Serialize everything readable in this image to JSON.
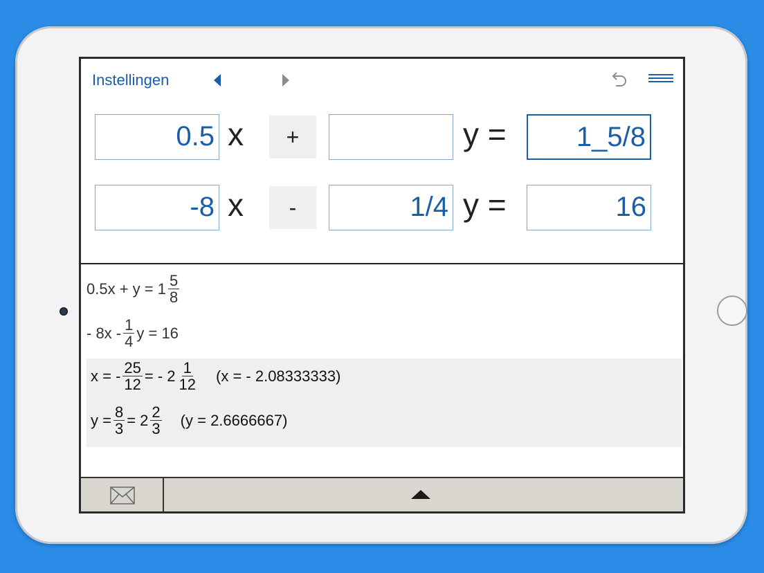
{
  "colors": {
    "background": "#2a8ce6",
    "accent": "#1a5ea8"
  },
  "nav": {
    "settings_label": "Instellingen",
    "prev_icon": "triangle-left-icon",
    "next_icon": "triangle-right-icon",
    "undo_icon": "undo-icon",
    "menu_icon": "menu-icon"
  },
  "equation1": {
    "a": "0.5",
    "x_label": "x",
    "operator": "+",
    "b": "",
    "y_label": "y =",
    "c": "1_5/8"
  },
  "equation2": {
    "a": "-8",
    "x_label": "x",
    "operator": "-",
    "b": "1/4",
    "y_label": "y =",
    "c": "16"
  },
  "results": {
    "eq1": {
      "prefix": "0.5x + y = 1",
      "frac_num": "5",
      "frac_den": "8"
    },
    "eq2": {
      "prefix": "- 8x -",
      "frac_num": "1",
      "frac_den": "4",
      "suffix": "y = 16"
    },
    "x_solution": {
      "prefix": "x = -",
      "frac1_num": "25",
      "frac1_den": "12",
      "middle": "= - 2",
      "frac2_num": "1",
      "frac2_den": "12",
      "approx": "(x = - 2.08333333)"
    },
    "y_solution": {
      "prefix": "y =",
      "frac1_num": "8",
      "frac1_den": "3",
      "middle": "= 2",
      "frac2_num": "2",
      "frac2_den": "3",
      "approx": "(y = 2.6666667)"
    }
  },
  "bottom_bar": {
    "mail_icon": "envelope-icon",
    "expand_icon": "triangle-up-icon"
  }
}
